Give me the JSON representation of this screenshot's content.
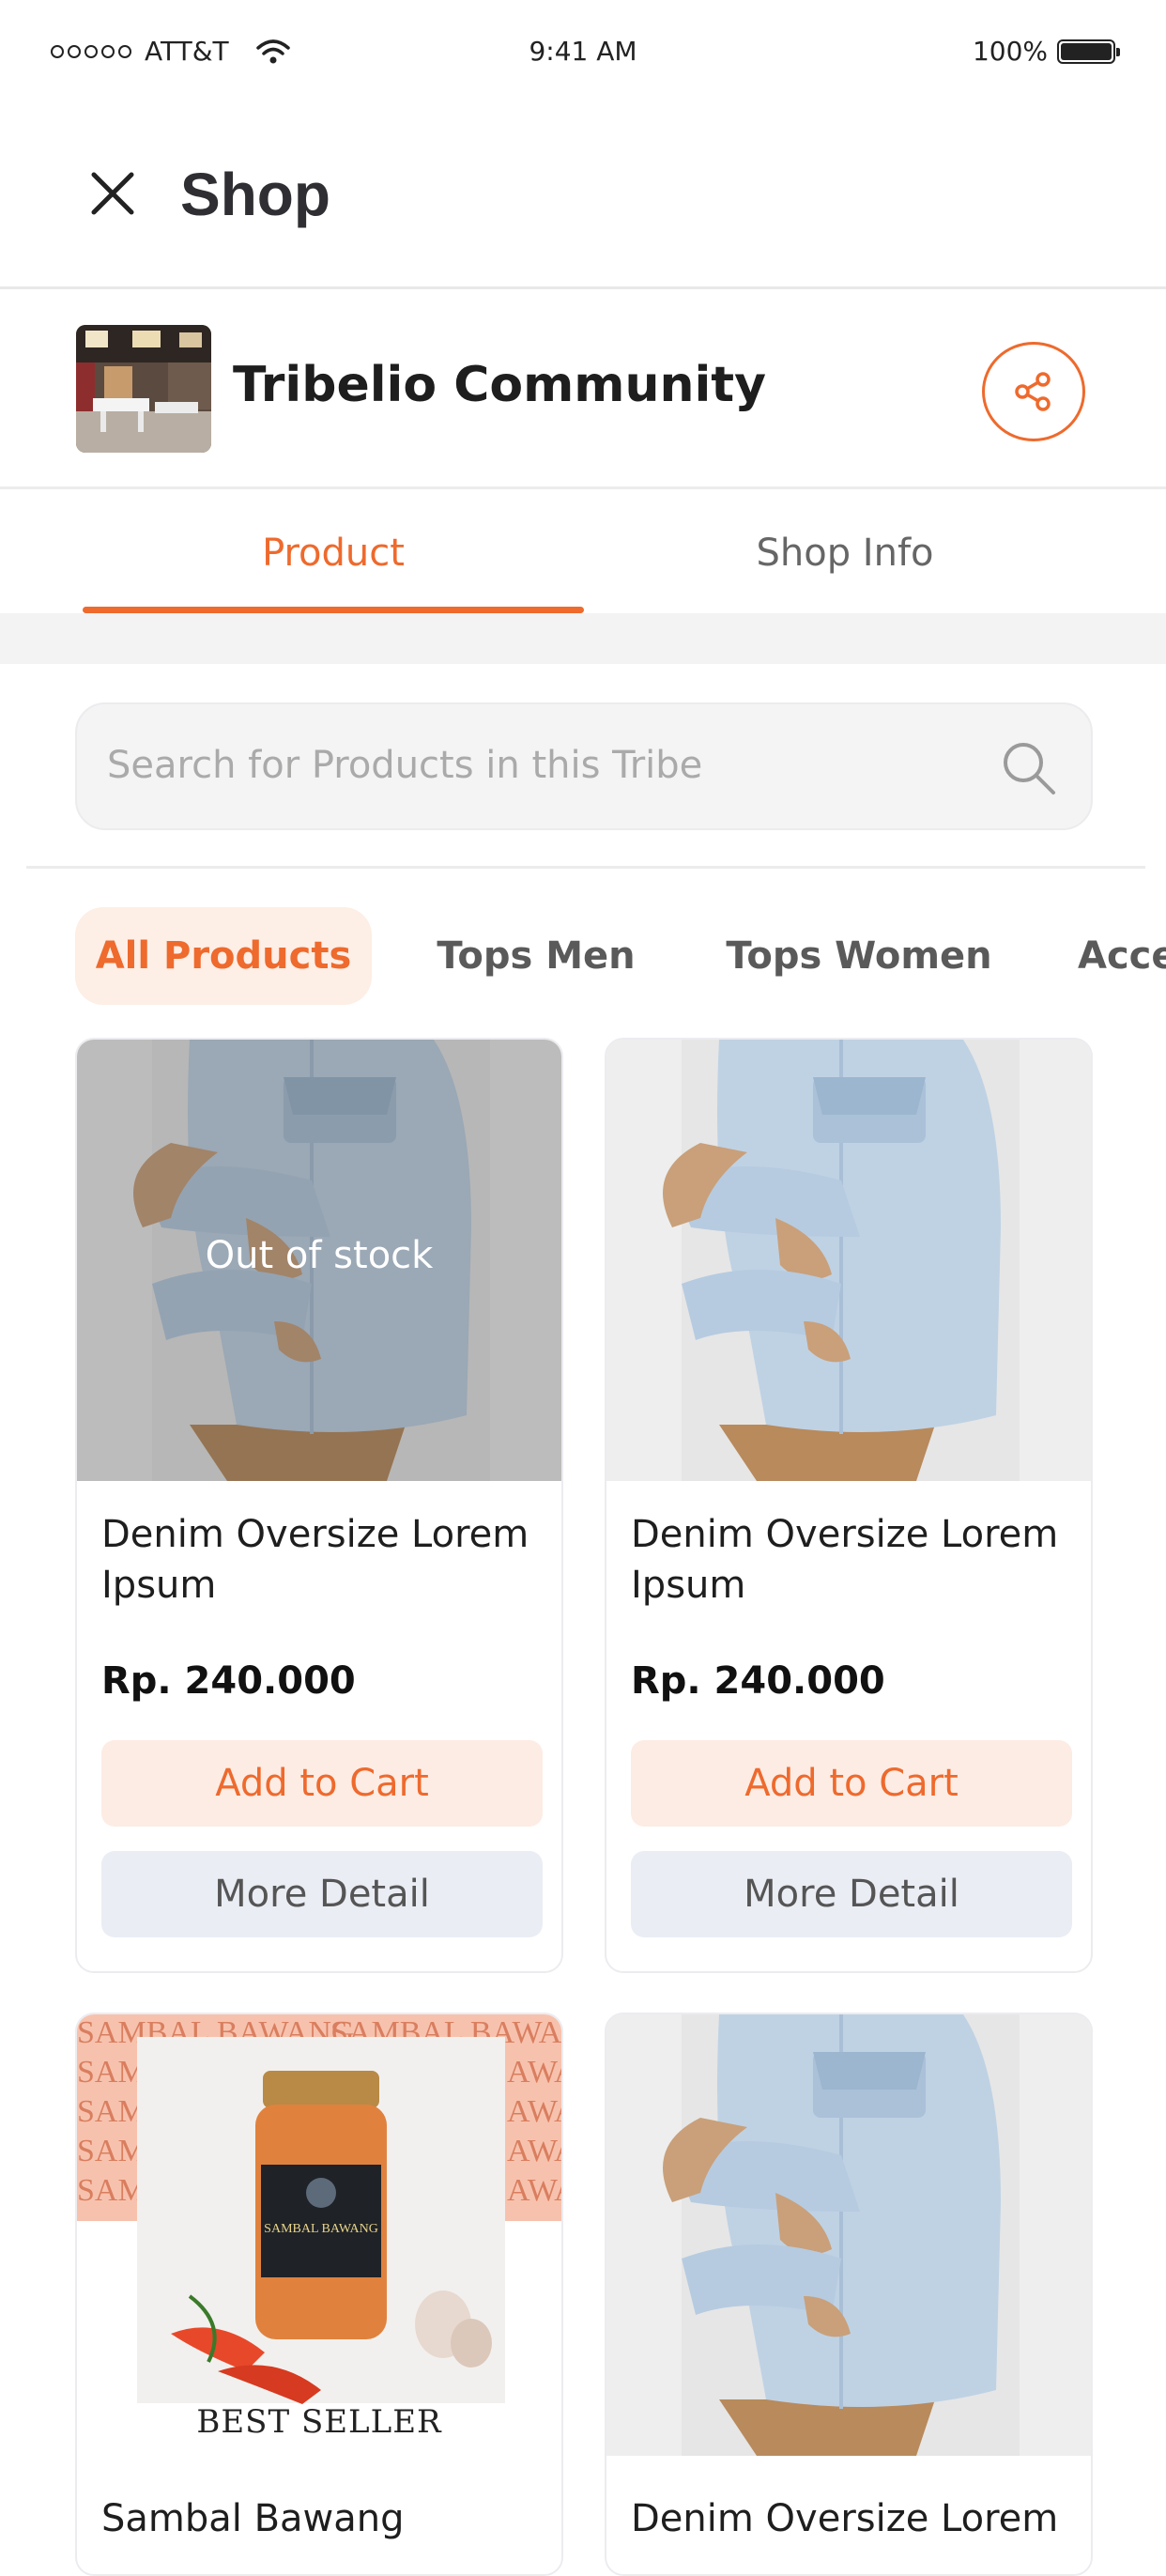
{
  "status_bar": {
    "carrier": "ATT&T",
    "time": "9:41 AM",
    "battery": "100%"
  },
  "header": {
    "title": "Shop"
  },
  "shop": {
    "name": "Tribelio Community"
  },
  "tabs": [
    {
      "label": "Product",
      "active": true
    },
    {
      "label": "Shop Info",
      "active": false
    }
  ],
  "search": {
    "placeholder": "Search for Products in this Tribe"
  },
  "categories": [
    {
      "label": "All Products",
      "active": true
    },
    {
      "label": "Tops Men"
    },
    {
      "label": "Tops Women"
    },
    {
      "label": "Acce"
    }
  ],
  "products": [
    {
      "name": "Denim Oversize Lorem Ipsum",
      "price": "Rp. 240.000",
      "status": "Out of stock",
      "add_to_cart": "Add to Cart",
      "more_detail": "More Detail"
    },
    {
      "name": "Denim Oversize Lorem Ipsum",
      "price": "Rp. 240.000",
      "add_to_cart": "Add to Cart",
      "more_detail": "More Detail"
    },
    {
      "name": "Sambal Bawang",
      "badge": "BEST SELLER",
      "image_text": "SAMBAL BAWANG",
      "label_text": "SAMBAL BAWANG"
    },
    {
      "name": "Denim Oversize Lorem"
    }
  ],
  "colors": {
    "accent": "#ee6a2d",
    "accent_light": "#fdece4",
    "detail_bg": "#eaedf4",
    "sambal_bg": "#f7c2ad"
  }
}
